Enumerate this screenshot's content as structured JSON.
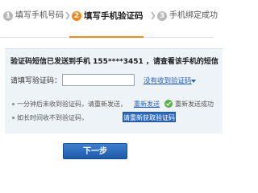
{
  "steps": [
    {
      "num": "1",
      "label": "填写手机号码",
      "active": false
    },
    {
      "num": "2",
      "label": "填写手机验证码",
      "active": true
    },
    {
      "num": "3",
      "label": "手机绑定成功",
      "active": false
    }
  ],
  "step_arrow": "❯",
  "accent_color": "#f08a1e",
  "link_color": "#2a63b8",
  "panel": {
    "sent_message": "验证码短信已发送到手机 155****3451 ，请查看该手机的短信",
    "code_label": "请填写验证码：",
    "code_value": "",
    "no_code_link": "没有收到验证码",
    "hint_resend": "一分钟后未收到验证码，请重新发送，",
    "resend_link": "重新发送",
    "resend_success": "重新发送成功",
    "hint_slow": "如长时间收不到验证码，",
    "reget_button": "请重新获取验证码"
  },
  "next_button": "下一步"
}
